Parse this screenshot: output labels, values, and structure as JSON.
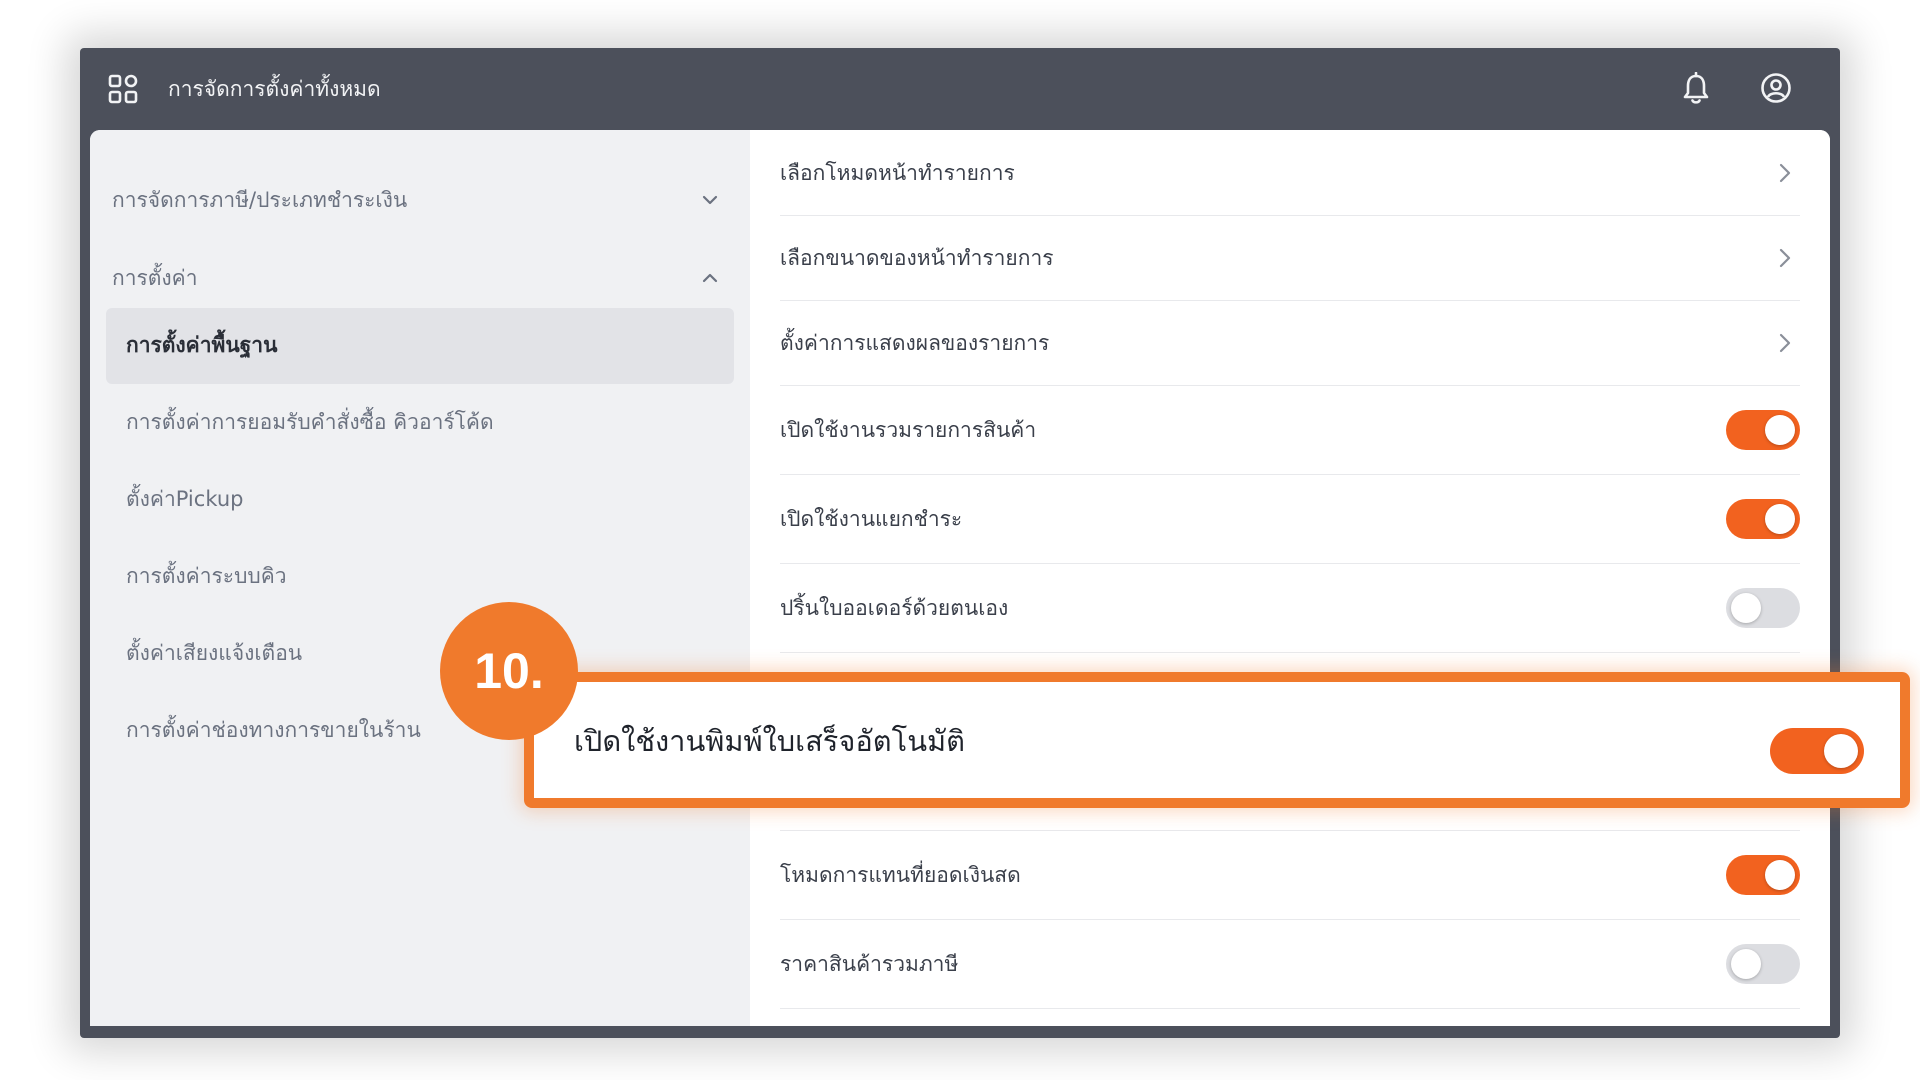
{
  "topbar": {
    "title": "การจัดการตั้งค่าทั้งหมด",
    "icons": [
      "apps-grid-icon",
      "bell-icon",
      "user-circle-icon"
    ]
  },
  "sidebar": {
    "groups": [
      {
        "label": "การจัดการภาษี/ประเภทชำระเงิน",
        "expanded": false
      },
      {
        "label": "การตั้งค่า",
        "expanded": true
      }
    ],
    "items": [
      {
        "label": "การตั้งค่าพื้นฐาน",
        "active": true
      },
      {
        "label": "การตั้งค่าการยอมรับคำสั่งซื้อ คิวอาร์โค้ด",
        "active": false
      },
      {
        "label": "ตั้งค่าPickup",
        "active": false
      },
      {
        "label": "การตั้งค่าระบบคิว",
        "active": false
      },
      {
        "label": "ตั้งค่าเสียงแจ้งเตือน",
        "active": false
      },
      {
        "label": "การตั้งค่าช่องทางการขายในร้าน",
        "active": false
      }
    ]
  },
  "main": {
    "rows": [
      {
        "label": "เลือกโหมดหน้าทำรายการ",
        "control": "chevron"
      },
      {
        "label": "เลือกขนาดของหน้าทำรายการ",
        "control": "chevron"
      },
      {
        "label": "ตั้งค่าการแสดงผลของรายการ",
        "control": "chevron"
      },
      {
        "label": "เปิดใช้งานรวมรายการสินค้า",
        "control": "toggle",
        "on": true
      },
      {
        "label": "เปิดใช้งานแยกชำระ",
        "control": "toggle",
        "on": true
      },
      {
        "label": "ปริ้นใบออเดอร์ด้วยตนเอง",
        "control": "toggle",
        "on": false
      },
      {
        "label": "โหมดการแทนที่ยอดเงินสด",
        "control": "toggle",
        "on": true
      },
      {
        "label": "ราคาสินค้ารวมภาษี",
        "control": "toggle",
        "on": false
      }
    ]
  },
  "callout": {
    "step": "10.",
    "label": "เปิดใช้งานพิมพ์ใบเสร็จอัตโนมัติ",
    "on": true
  },
  "colors": {
    "accent": "#f2621f",
    "callout": "#f07a2c",
    "topbar": "#4c505b",
    "sidebar": "#f0f1f3"
  }
}
